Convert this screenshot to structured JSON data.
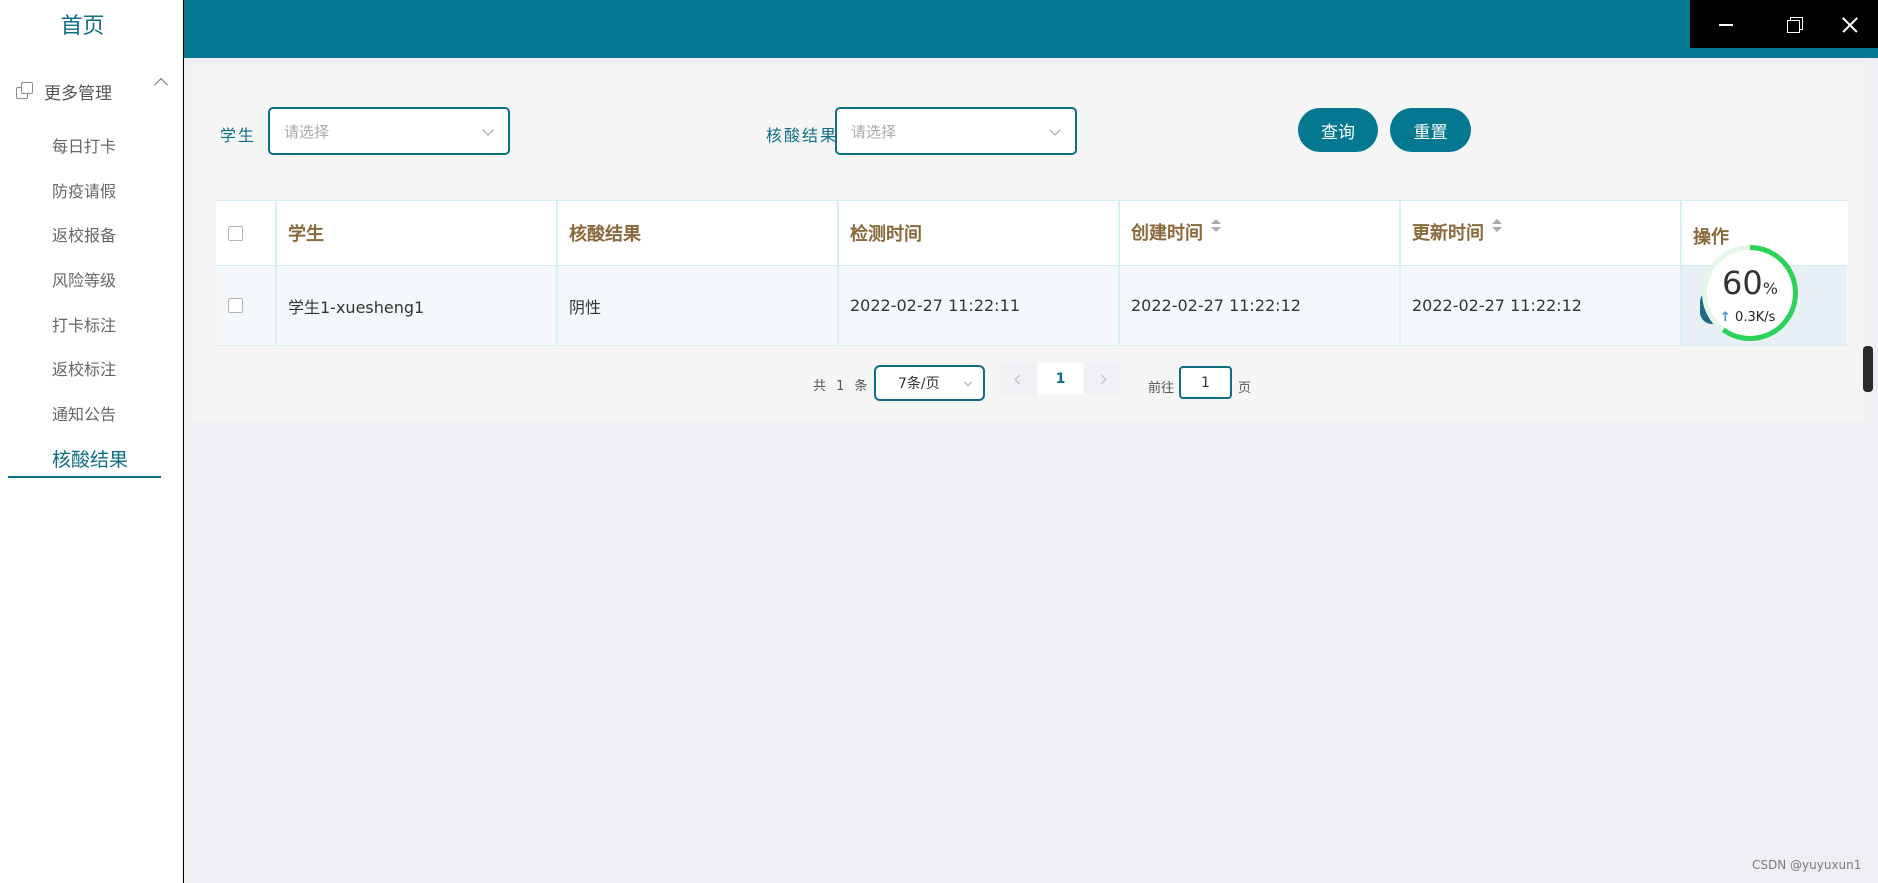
{
  "sidebar": {
    "home": "首页",
    "group_label": "更多管理",
    "items": [
      {
        "label": "每日打卡"
      },
      {
        "label": "防疫请假"
      },
      {
        "label": "返校报备"
      },
      {
        "label": "风险等级"
      },
      {
        "label": "打卡标注"
      },
      {
        "label": "返校标注"
      },
      {
        "label": "通知公告"
      },
      {
        "label": "核酸结果",
        "active": true
      }
    ]
  },
  "filters": {
    "student_label": "学生",
    "student_placeholder": "请选择",
    "result_label": "核酸结果",
    "result_placeholder": "请选择",
    "query_button": "查询",
    "reset_button": "重置"
  },
  "table": {
    "columns": [
      "学生",
      "核酸结果",
      "检测时间",
      "创建时间",
      "更新时间",
      "操作"
    ],
    "rows": [
      {
        "student": "学生1-xuesheng1",
        "result": "阴性",
        "test_time": "2022-02-27 11:22:11",
        "created": "2022-02-27 11:22:12",
        "updated": "2022-02-27 11:22:12"
      }
    ]
  },
  "pagination": {
    "total": "共 1 条",
    "page_size": "7条/页",
    "current_page": "1",
    "goto_label": "前往",
    "goto_value": "1",
    "goto_unit": "页"
  },
  "speed_widget": {
    "percent": "60",
    "percent_unit": "%",
    "arrow": "↑",
    "rate": "0.3K/s",
    "level": 0.6
  },
  "watermark": "CSDN @yuyuxun1",
  "colors": {
    "accent": "#047891",
    "header_text": "#8a6a3c",
    "progress": "#2bd35a"
  }
}
